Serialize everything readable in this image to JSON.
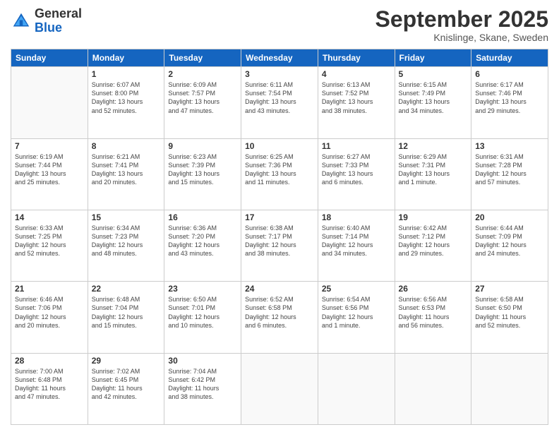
{
  "header": {
    "logo_general": "General",
    "logo_blue": "Blue",
    "month_title": "September 2025",
    "subtitle": "Knislinge, Skane, Sweden"
  },
  "days_of_week": [
    "Sunday",
    "Monday",
    "Tuesday",
    "Wednesday",
    "Thursday",
    "Friday",
    "Saturday"
  ],
  "weeks": [
    [
      {
        "day": "",
        "info": ""
      },
      {
        "day": "1",
        "info": "Sunrise: 6:07 AM\nSunset: 8:00 PM\nDaylight: 13 hours\nand 52 minutes."
      },
      {
        "day": "2",
        "info": "Sunrise: 6:09 AM\nSunset: 7:57 PM\nDaylight: 13 hours\nand 47 minutes."
      },
      {
        "day": "3",
        "info": "Sunrise: 6:11 AM\nSunset: 7:54 PM\nDaylight: 13 hours\nand 43 minutes."
      },
      {
        "day": "4",
        "info": "Sunrise: 6:13 AM\nSunset: 7:52 PM\nDaylight: 13 hours\nand 38 minutes."
      },
      {
        "day": "5",
        "info": "Sunrise: 6:15 AM\nSunset: 7:49 PM\nDaylight: 13 hours\nand 34 minutes."
      },
      {
        "day": "6",
        "info": "Sunrise: 6:17 AM\nSunset: 7:46 PM\nDaylight: 13 hours\nand 29 minutes."
      }
    ],
    [
      {
        "day": "7",
        "info": "Sunrise: 6:19 AM\nSunset: 7:44 PM\nDaylight: 13 hours\nand 25 minutes."
      },
      {
        "day": "8",
        "info": "Sunrise: 6:21 AM\nSunset: 7:41 PM\nDaylight: 13 hours\nand 20 minutes."
      },
      {
        "day": "9",
        "info": "Sunrise: 6:23 AM\nSunset: 7:39 PM\nDaylight: 13 hours\nand 15 minutes."
      },
      {
        "day": "10",
        "info": "Sunrise: 6:25 AM\nSunset: 7:36 PM\nDaylight: 13 hours\nand 11 minutes."
      },
      {
        "day": "11",
        "info": "Sunrise: 6:27 AM\nSunset: 7:33 PM\nDaylight: 13 hours\nand 6 minutes."
      },
      {
        "day": "12",
        "info": "Sunrise: 6:29 AM\nSunset: 7:31 PM\nDaylight: 13 hours\nand 1 minute."
      },
      {
        "day": "13",
        "info": "Sunrise: 6:31 AM\nSunset: 7:28 PM\nDaylight: 12 hours\nand 57 minutes."
      }
    ],
    [
      {
        "day": "14",
        "info": "Sunrise: 6:33 AM\nSunset: 7:25 PM\nDaylight: 12 hours\nand 52 minutes."
      },
      {
        "day": "15",
        "info": "Sunrise: 6:34 AM\nSunset: 7:23 PM\nDaylight: 12 hours\nand 48 minutes."
      },
      {
        "day": "16",
        "info": "Sunrise: 6:36 AM\nSunset: 7:20 PM\nDaylight: 12 hours\nand 43 minutes."
      },
      {
        "day": "17",
        "info": "Sunrise: 6:38 AM\nSunset: 7:17 PM\nDaylight: 12 hours\nand 38 minutes."
      },
      {
        "day": "18",
        "info": "Sunrise: 6:40 AM\nSunset: 7:14 PM\nDaylight: 12 hours\nand 34 minutes."
      },
      {
        "day": "19",
        "info": "Sunrise: 6:42 AM\nSunset: 7:12 PM\nDaylight: 12 hours\nand 29 minutes."
      },
      {
        "day": "20",
        "info": "Sunrise: 6:44 AM\nSunset: 7:09 PM\nDaylight: 12 hours\nand 24 minutes."
      }
    ],
    [
      {
        "day": "21",
        "info": "Sunrise: 6:46 AM\nSunset: 7:06 PM\nDaylight: 12 hours\nand 20 minutes."
      },
      {
        "day": "22",
        "info": "Sunrise: 6:48 AM\nSunset: 7:04 PM\nDaylight: 12 hours\nand 15 minutes."
      },
      {
        "day": "23",
        "info": "Sunrise: 6:50 AM\nSunset: 7:01 PM\nDaylight: 12 hours\nand 10 minutes."
      },
      {
        "day": "24",
        "info": "Sunrise: 6:52 AM\nSunset: 6:58 PM\nDaylight: 12 hours\nand 6 minutes."
      },
      {
        "day": "25",
        "info": "Sunrise: 6:54 AM\nSunset: 6:56 PM\nDaylight: 12 hours\nand 1 minute."
      },
      {
        "day": "26",
        "info": "Sunrise: 6:56 AM\nSunset: 6:53 PM\nDaylight: 11 hours\nand 56 minutes."
      },
      {
        "day": "27",
        "info": "Sunrise: 6:58 AM\nSunset: 6:50 PM\nDaylight: 11 hours\nand 52 minutes."
      }
    ],
    [
      {
        "day": "28",
        "info": "Sunrise: 7:00 AM\nSunset: 6:48 PM\nDaylight: 11 hours\nand 47 minutes."
      },
      {
        "day": "29",
        "info": "Sunrise: 7:02 AM\nSunset: 6:45 PM\nDaylight: 11 hours\nand 42 minutes."
      },
      {
        "day": "30",
        "info": "Sunrise: 7:04 AM\nSunset: 6:42 PM\nDaylight: 11 hours\nand 38 minutes."
      },
      {
        "day": "",
        "info": ""
      },
      {
        "day": "",
        "info": ""
      },
      {
        "day": "",
        "info": ""
      },
      {
        "day": "",
        "info": ""
      }
    ]
  ]
}
